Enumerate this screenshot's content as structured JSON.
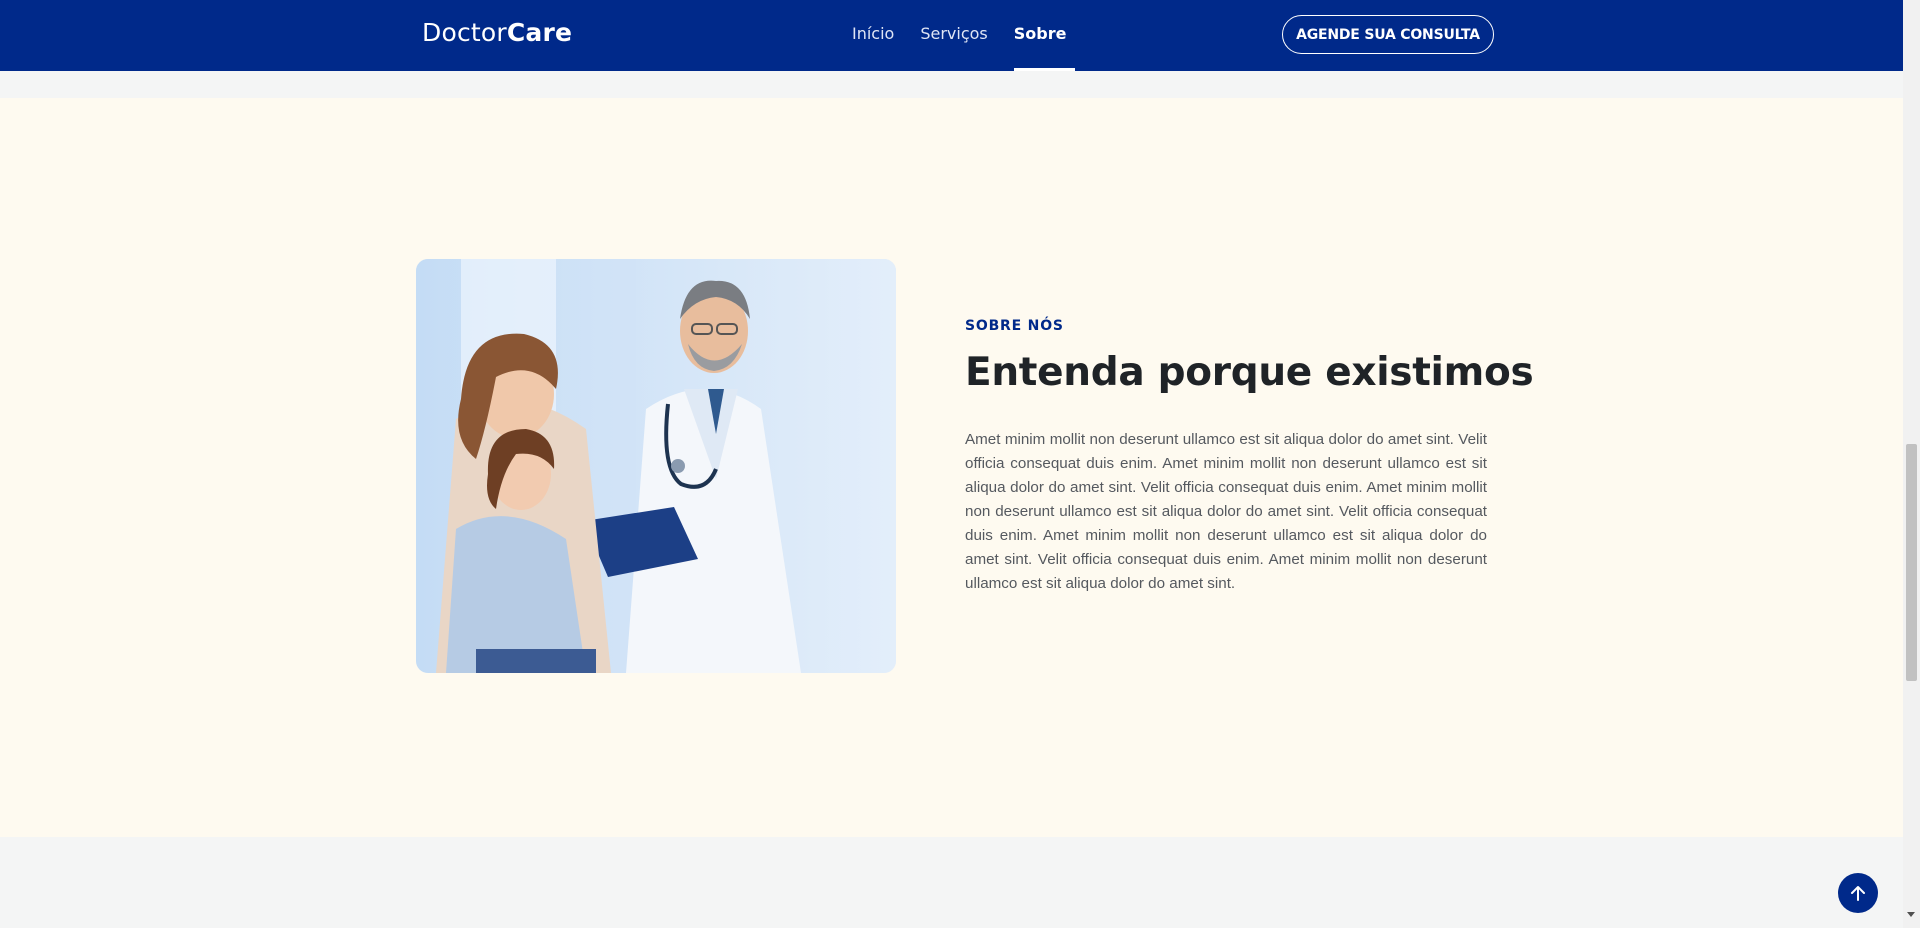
{
  "header": {
    "logo_light": "Doctor",
    "logo_bold": "Care",
    "nav": [
      {
        "label": "Início",
        "active": false
      },
      {
        "label": "Serviços",
        "active": false
      },
      {
        "label": "Sobre",
        "active": true
      }
    ],
    "cta_label": "AGENDE SUA CONSULTA"
  },
  "about": {
    "eyebrow": "SOBRE NÓS",
    "title": "Entenda porque existimos",
    "text": "Amet minim mollit non deserunt ullamco est sit aliqua dolor do amet sint. Velit officia consequat duis enim. Amet minim mollit non deserunt ullamco est sit aliqua dolor do amet sint. Velit officia consequat duis enim. Amet minim mollit non deserunt ullamco est sit aliqua dolor do amet sint. Velit officia consequat duis enim. Amet minim mollit non deserunt ullamco est sit aliqua dolor do amet sint. Velit officia consequat duis enim. Amet minim mollit non deserunt ullamco est sit aliqua dolor do amet sint."
  },
  "colors": {
    "brand": "#00298a",
    "section_bg": "#fefaf0",
    "page_bg": "#f4f5f5",
    "heading": "#1f2327",
    "body_text": "#55595f"
  },
  "icons": {
    "back_to_top": "arrow-up-icon",
    "photo": "doctor-family-photo"
  }
}
